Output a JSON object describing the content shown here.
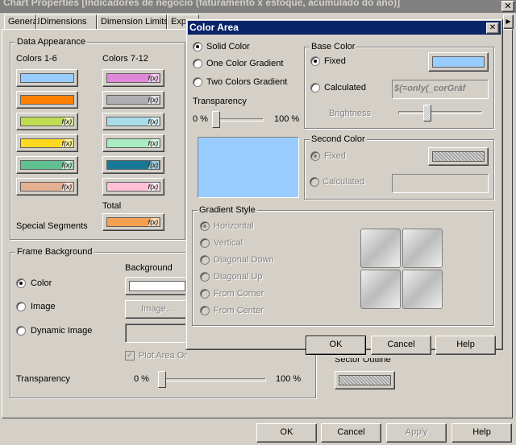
{
  "window": {
    "title": "Chart Properties [Indicadores de negócio (faturamento x estoque, acumulado do ano)]"
  },
  "tabs": [
    "General",
    "Dimensions",
    "Dimension Limits",
    "Exp"
  ],
  "data_appearance": {
    "title": "Data Appearance",
    "colors_1_6_label": "Colors 1-6",
    "colors_7_12_label": "Colors 7-12",
    "colors_1_6": [
      {
        "color": "#99ccff",
        "fx": ""
      },
      {
        "color": "#ff8000",
        "fx": ""
      },
      {
        "color": "#c0dc50",
        "fx": "f(x)"
      },
      {
        "color": "#ffd820",
        "fx": "f(x)"
      },
      {
        "color": "#60c090",
        "fx": "f(x)"
      },
      {
        "color": "#e4b090",
        "fx": "f(x)"
      }
    ],
    "colors_7_12": [
      {
        "color": "#e088d8",
        "fx": "f(x)"
      },
      {
        "color": "#b0b0b4",
        "fx": "f(x)"
      },
      {
        "color": "#a8dce8",
        "fx": "f(x)"
      },
      {
        "color": "#a8ecc0",
        "fx": "f(x)"
      },
      {
        "color": "#187898",
        "fx": "f(x)"
      },
      {
        "color": "#ffc0d8",
        "fx": "f(x)"
      }
    ],
    "total_label": "Total",
    "total_color": "#f8a050",
    "total_fx": "f(x)",
    "special_segments_label": "Special Segments"
  },
  "frame_background": {
    "title": "Frame Background",
    "background_label": "Background",
    "color_label": "Color",
    "image_label": "Image",
    "dynamic_image_label": "Dynamic Image",
    "image_button": "Image...",
    "plot_area_label": "Plot Area Only",
    "transparency_label": "Transparency",
    "min": "0 %",
    "max": "100 %",
    "transparency_value": 0,
    "background_color": "#ffffff"
  },
  "sector_outline_label": "Sector Outline",
  "footer": {
    "ok": "OK",
    "cancel": "Cancel",
    "apply": "Apply",
    "help": "Help"
  },
  "dialog": {
    "title": "Color Area",
    "solid_color": "Solid Color",
    "one_color_gradient": "One Color Gradient",
    "two_colors_gradient": "Two Colors Gradient",
    "transparency_label": "Transparency",
    "min": "0 %",
    "max": "100 %",
    "transparency_value": 0,
    "preview_color": "#99ccff",
    "base_color": {
      "title": "Base Color",
      "fixed": "Fixed",
      "calculated": "Calculated",
      "calculated_value": "$(=only(_corGráf",
      "brightness": "Brightness",
      "color": "#99ccff",
      "brightness_value": 50
    },
    "second_color": {
      "title": "Second Color",
      "fixed": "Fixed",
      "calculated": "Calculated"
    },
    "gradient_style": {
      "title": "Gradient Style",
      "options": [
        "Horizontal",
        "Vertical",
        "Diagonal Down",
        "Diagonal Up",
        "From Corner",
        "From Center"
      ]
    },
    "ok": "OK",
    "cancel": "Cancel",
    "help": "Help"
  }
}
